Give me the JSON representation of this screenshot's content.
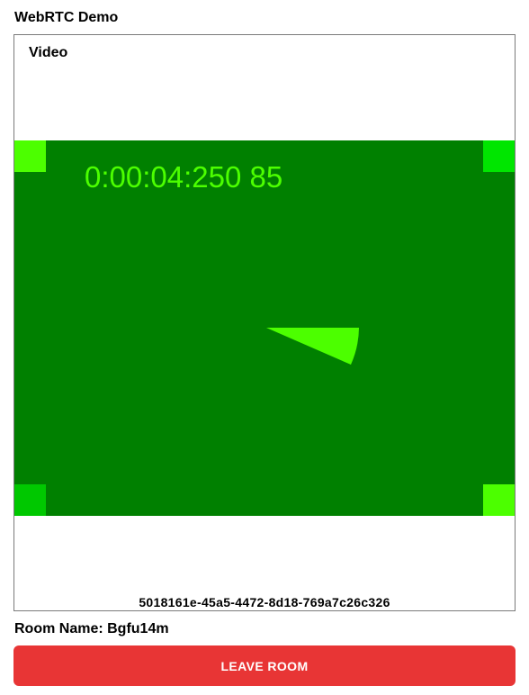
{
  "app": {
    "title": "WebRTC Demo"
  },
  "video_panel": {
    "heading": "Video",
    "stream": {
      "timecode": "0:00:04:250 85",
      "corner_colors": {
        "top_left": "#4cff00",
        "top_right": "#00e600",
        "bottom_left": "#00c800",
        "bottom_right": "#4cff00"
      },
      "background_color": "#008000",
      "overlay_color": "#4cff00"
    },
    "peer_id": "5018161e-45a5-4472-8d18-769a7c26c326"
  },
  "room": {
    "label": "Room Name: Bgfu14m"
  },
  "actions": {
    "leave_label": "LEAVE ROOM",
    "leave_color": "#e83535"
  }
}
